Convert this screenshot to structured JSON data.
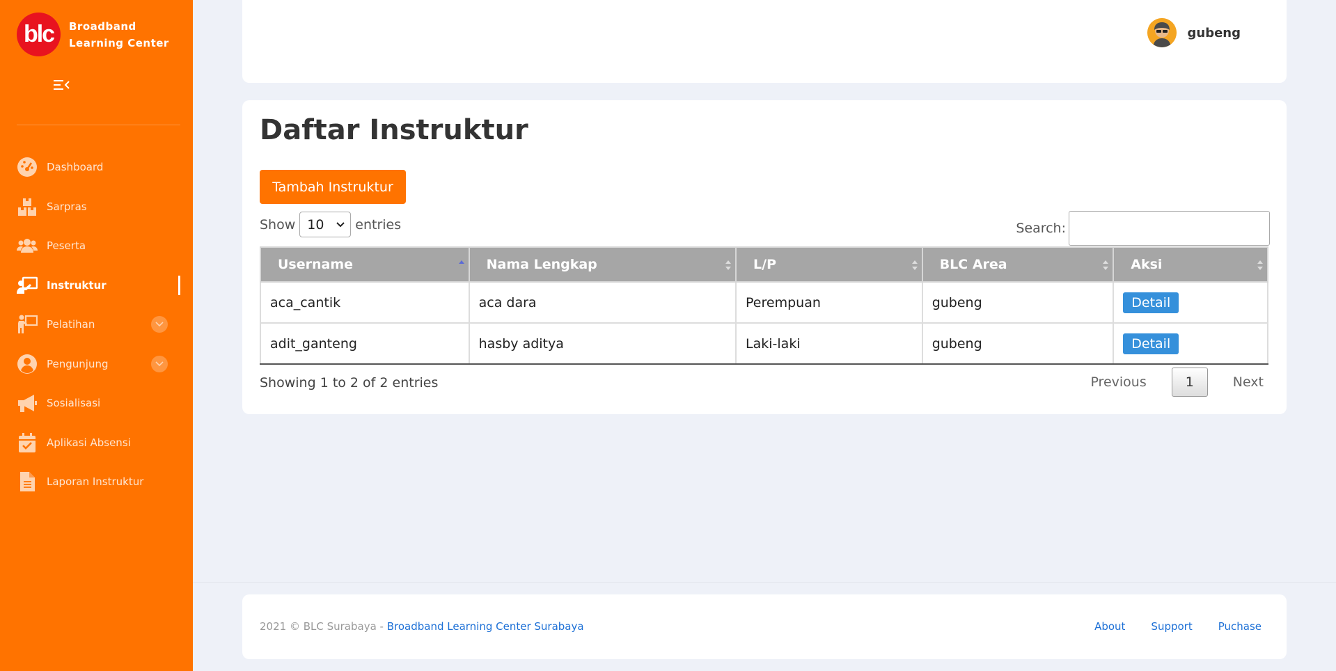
{
  "brand": {
    "logo_text": "blc",
    "name": "Broadband Learning Center"
  },
  "sidebar": {
    "items": [
      {
        "label": "Dashboard",
        "icon": "dashboard-gauge-icon"
      },
      {
        "label": "Sarpras",
        "icon": "boxes-icon"
      },
      {
        "label": "Peserta",
        "icon": "users-icon"
      },
      {
        "label": "Instruktur",
        "icon": "chalkboard-teacher-icon",
        "active": true
      },
      {
        "label": "Pelatihan",
        "icon": "person-chalkboard-icon",
        "has_submenu": true
      },
      {
        "label": "Pengunjung",
        "icon": "user-circle-icon",
        "has_submenu": true
      },
      {
        "label": "Sosialisasi",
        "icon": "megaphone-icon"
      },
      {
        "label": "Aplikasi Absensi",
        "icon": "calendar-check-icon"
      },
      {
        "label": "Laporan Instruktur",
        "icon": "file-document-icon"
      }
    ]
  },
  "header": {
    "username": "gubeng"
  },
  "main": {
    "title": "Daftar Instruktur",
    "add_button": "Tambah Instruktur",
    "length": {
      "show": "Show",
      "value": "10",
      "entries": "entries"
    },
    "search": {
      "label": "Search:",
      "value": ""
    },
    "table": {
      "headers": [
        "Username",
        "Nama Lengkap",
        "L/P",
        "BLC Area",
        "Aksi"
      ],
      "sorted_column": "Username",
      "rows": [
        {
          "username": "aca_cantik",
          "nama": "aca dara",
          "lp": "Perempuan",
          "area": "gubeng",
          "aksi": "Detail"
        },
        {
          "username": "adit_ganteng",
          "nama": "hasby aditya",
          "lp": "Laki-laki",
          "area": "gubeng",
          "aksi": "Detail"
        }
      ]
    },
    "info": "Showing 1 to 2 of 2 entries",
    "pagination": {
      "previous": "Previous",
      "current": "1",
      "next": "Next"
    }
  },
  "footer": {
    "copyright": "2021 © BLC Surabaya - ",
    "link": "Broadband Learning Center Surabaya",
    "links": [
      "About",
      "Support",
      "Puchase"
    ]
  },
  "colors": {
    "brand_orange": "#ff7300",
    "logo_red": "#e8131f",
    "detail_blue": "#3590db",
    "link_blue": "#1d70d6",
    "table_header": "#a6a6a6"
  }
}
